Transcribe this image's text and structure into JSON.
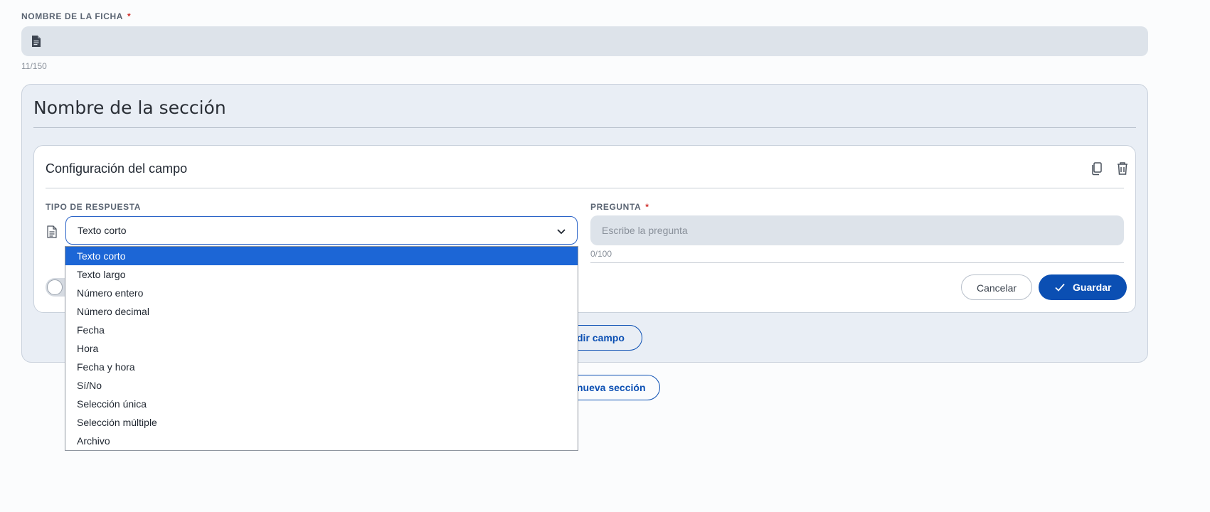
{
  "ficha": {
    "label": "NOMBRE DE LA FICHA",
    "required_mark": "*",
    "value": "",
    "counter": "11/150",
    "icon": "document-icon"
  },
  "section": {
    "title": "Nombre de la sección",
    "add_field_label": "dir campo",
    "new_section_label": "nueva sección"
  },
  "field": {
    "title": "Configuración del campo",
    "response_type_label": "TIPO DE RESPUESTA",
    "selected_type": "Texto corto",
    "question_label": "PREGUNTA",
    "question_required_mark": "*",
    "question_placeholder": "Escribe la pregunta",
    "question_counter": "0/100",
    "cancel_label": "Cancelar",
    "save_label": "Guardar",
    "icons": [
      "copy-icon",
      "trash-icon"
    ]
  },
  "dropdown": {
    "options": [
      "Texto corto",
      "Texto largo",
      "Número entero",
      "Número decimal",
      "Fecha",
      "Hora",
      "Fecha y hora",
      "Sí/No",
      "Selección única",
      "Selección múltiple",
      "Archivo"
    ],
    "selected": "Texto corto"
  },
  "colors": {
    "accent": "#0b4fb3",
    "selected_option": "#1c66d6",
    "required": "#d0312d"
  }
}
